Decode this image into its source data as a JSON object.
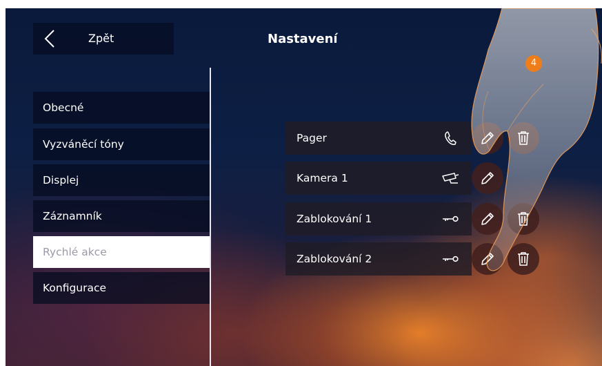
{
  "header": {
    "back_label": "Zpět",
    "title": "Nastavení"
  },
  "sidebar": {
    "items": [
      {
        "label": "Obecné",
        "active": false
      },
      {
        "label": "Vyzváněcí tóny",
        "active": false
      },
      {
        "label": "Displej",
        "active": false
      },
      {
        "label": "Záznamník",
        "active": false
      },
      {
        "label": "Rychlé akce",
        "active": true
      },
      {
        "label": "Konfigurace",
        "active": false
      }
    ]
  },
  "quick_actions": [
    {
      "label": "Pager",
      "icon": "phone-icon"
    },
    {
      "label": "Kamera 1",
      "icon": "camera-icon"
    },
    {
      "label": "Zablokování 1",
      "icon": "key-icon"
    },
    {
      "label": "Zablokování 2",
      "icon": "key-icon"
    }
  ],
  "step_badge": "4",
  "colors": {
    "accent_orange": "#ef7d1a",
    "panel_dark": "#050c20",
    "active_item_bg": "#ffffff",
    "active_item_text": "#9a9aa8"
  }
}
